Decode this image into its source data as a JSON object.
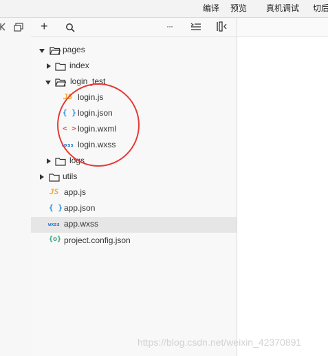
{
  "menu": {
    "compile": "编译",
    "preview": "预览",
    "device_debug": "真机调试",
    "switch_bg": "切后"
  },
  "toolbar": {
    "add_icon": "+",
    "more_icon": "···"
  },
  "tree": {
    "pages": "pages",
    "index": "index",
    "login_test": "login_test",
    "login_js": "login.js",
    "login_json": "login.json",
    "login_wxml": "login.wxml",
    "login_wxss": "login.wxss",
    "logs": "logs",
    "utils": "utils",
    "app_js": "app.js",
    "app_json": "app.json",
    "app_wxss": "app.wxss",
    "project_config": "project.config.json"
  },
  "icons": {
    "js": "JS",
    "json": "{ }",
    "wxml": "< >",
    "wxss": "wxss",
    "config": "{o}"
  },
  "watermark": "https://blog.csdn.net/weixin_42370891",
  "colors": {
    "annotation_circle": "#e53935",
    "selected_row": "#e6e6e6"
  }
}
